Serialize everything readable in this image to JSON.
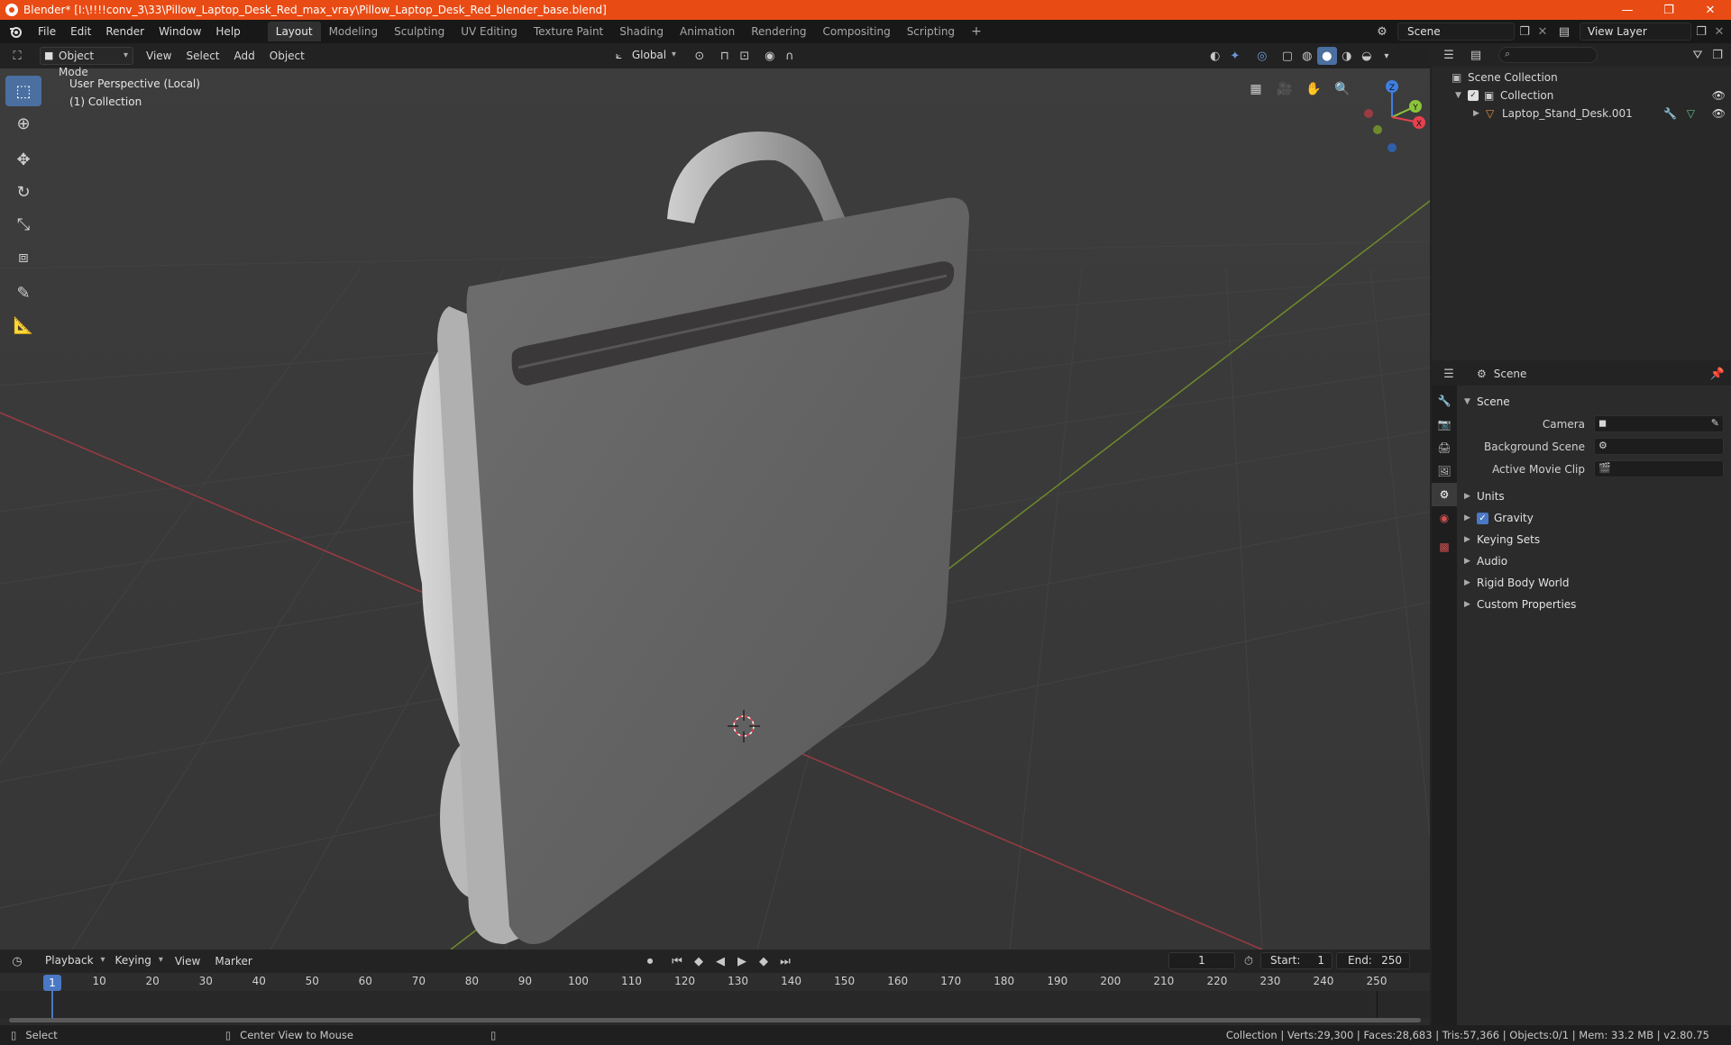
{
  "window": {
    "title": "Blender* [I:\\!!!!conv_3\\33\\Pillow_Laptop_Desk_Red_max_vray\\Pillow_Laptop_Desk_Red_blender_base.blend]",
    "minimize": "—",
    "maximize": "❐",
    "close": "✕"
  },
  "menubar": {
    "menus": [
      "File",
      "Edit",
      "Render",
      "Window",
      "Help"
    ],
    "workspaces": [
      "Layout",
      "Modeling",
      "Sculpting",
      "UV Editing",
      "Texture Paint",
      "Shading",
      "Animation",
      "Rendering",
      "Compositing",
      "Scripting"
    ],
    "active_workspace": "Layout",
    "add_workspace": "+",
    "scene_name": "Scene",
    "view_layer": "View Layer"
  },
  "viewport": {
    "mode": "Object Mode",
    "menus": [
      "View",
      "Select",
      "Add",
      "Object"
    ],
    "transform_orientation": "Global",
    "info_line1": "User Perspective (Local)",
    "info_line2": "(1) Collection",
    "gizmo_axes": {
      "x": "X",
      "y": "Y",
      "z": "Z"
    }
  },
  "outliner": {
    "search_placeholder": "",
    "root": "Scene Collection",
    "collection": "Collection",
    "object": "Laptop_Stand_Desk.001"
  },
  "properties": {
    "context": "Scene",
    "panel_title": "Scene",
    "fields": [
      {
        "label": "Camera"
      },
      {
        "label": "Background Scene"
      },
      {
        "label": "Active Movie Clip"
      }
    ],
    "subpanels": [
      "Units",
      "Gravity",
      "Keying Sets",
      "Audio",
      "Rigid Body World",
      "Custom Properties"
    ],
    "gravity_checked": true
  },
  "timeline": {
    "menus": [
      "Playback",
      "Keying",
      "View",
      "Marker"
    ],
    "current_frame": "1",
    "start_label": "Start:",
    "start": "1",
    "end_label": "End:",
    "end": "250",
    "ticks": [
      "1",
      "10",
      "20",
      "30",
      "40",
      "50",
      "60",
      "70",
      "80",
      "90",
      "100",
      "110",
      "120",
      "130",
      "140",
      "150",
      "160",
      "170",
      "180",
      "190",
      "200",
      "210",
      "220",
      "230",
      "240",
      "250"
    ]
  },
  "statusbar": {
    "select": "Select",
    "center_view": "Center View to Mouse",
    "stats": "Collection | Verts:29,300 | Faces:28,683 | Tris:57,366 | Objects:0/1 | Mem: 33.2 MB | v2.80.75"
  },
  "colors": {
    "title_bar": "#e94b14",
    "accent_blue": "#4a78c4",
    "x_axis": "#e8404d",
    "y_axis": "#8bc43a",
    "z_axis": "#3f7fe0"
  }
}
